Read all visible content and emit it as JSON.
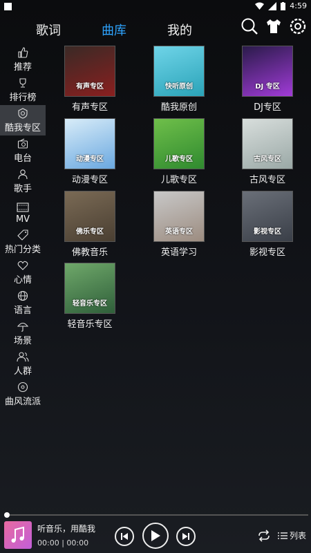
{
  "status": {
    "time": "4:59"
  },
  "nav": {
    "tabs": [
      "歌词",
      "曲库",
      "我的"
    ],
    "active_tab": "曲库",
    "icons": [
      "search-icon",
      "skin-icon",
      "settings-icon"
    ]
  },
  "sidebar": {
    "items": [
      {
        "label": "推荐",
        "icon": "thumbs-up-icon"
      },
      {
        "label": "排行榜",
        "icon": "trophy-icon"
      },
      {
        "label": "酷我专区",
        "icon": "kuwo-badge-icon",
        "active": true
      },
      {
        "label": "电台",
        "icon": "radio-icon"
      },
      {
        "label": "歌手",
        "icon": "person-icon"
      },
      {
        "label": "MV",
        "icon": "film-icon"
      },
      {
        "label": "热门分类",
        "icon": "tag-icon"
      },
      {
        "label": "心情",
        "icon": "heart-icon"
      },
      {
        "label": "语言",
        "icon": "globe-icon"
      },
      {
        "label": "场景",
        "icon": "umbrella-icon"
      },
      {
        "label": "人群",
        "icon": "people-icon"
      },
      {
        "label": "曲风流派",
        "icon": "disc-icon"
      }
    ]
  },
  "grid": {
    "items": [
      {
        "label": "有声专区",
        "caption": "有声专区",
        "colors": [
          "#3a2a26",
          "#8a1f1f"
        ]
      },
      {
        "label": "酷我原创",
        "caption": "快听原创",
        "colors": [
          "#6fd4e8",
          "#2aa3b8"
        ]
      },
      {
        "label": "DJ专区",
        "caption": "DJ 专区",
        "colors": [
          "#2a1b4a",
          "#a13bd8"
        ]
      },
      {
        "label": "动漫专区",
        "caption": "动漫专区",
        "colors": [
          "#d8ecf8",
          "#6aa8e0"
        ]
      },
      {
        "label": "儿歌专区",
        "caption": "儿歌专区",
        "colors": [
          "#6fbf4a",
          "#2f8a2f"
        ]
      },
      {
        "label": "古风专区",
        "caption": "古风专区",
        "colors": [
          "#d8dedc",
          "#9aa8a6"
        ]
      },
      {
        "label": "佛教音乐",
        "caption": "佛乐专区",
        "colors": [
          "#7a6a55",
          "#4a3f32"
        ]
      },
      {
        "label": "英语学习",
        "caption": "英语专区",
        "colors": [
          "#c8c8c8",
          "#9c8c80"
        ]
      },
      {
        "label": "影视专区",
        "caption": "影视专区",
        "colors": [
          "#6a6f78",
          "#3a3f48"
        ]
      },
      {
        "label": "轻音乐专区",
        "caption": "轻音乐专区",
        "colors": [
          "#6fa86a",
          "#2f5f3a"
        ]
      }
    ]
  },
  "player": {
    "title": "听音乐，用酷我",
    "time": "00:00 | 00:00",
    "list_label": "列表",
    "progress": 0
  }
}
